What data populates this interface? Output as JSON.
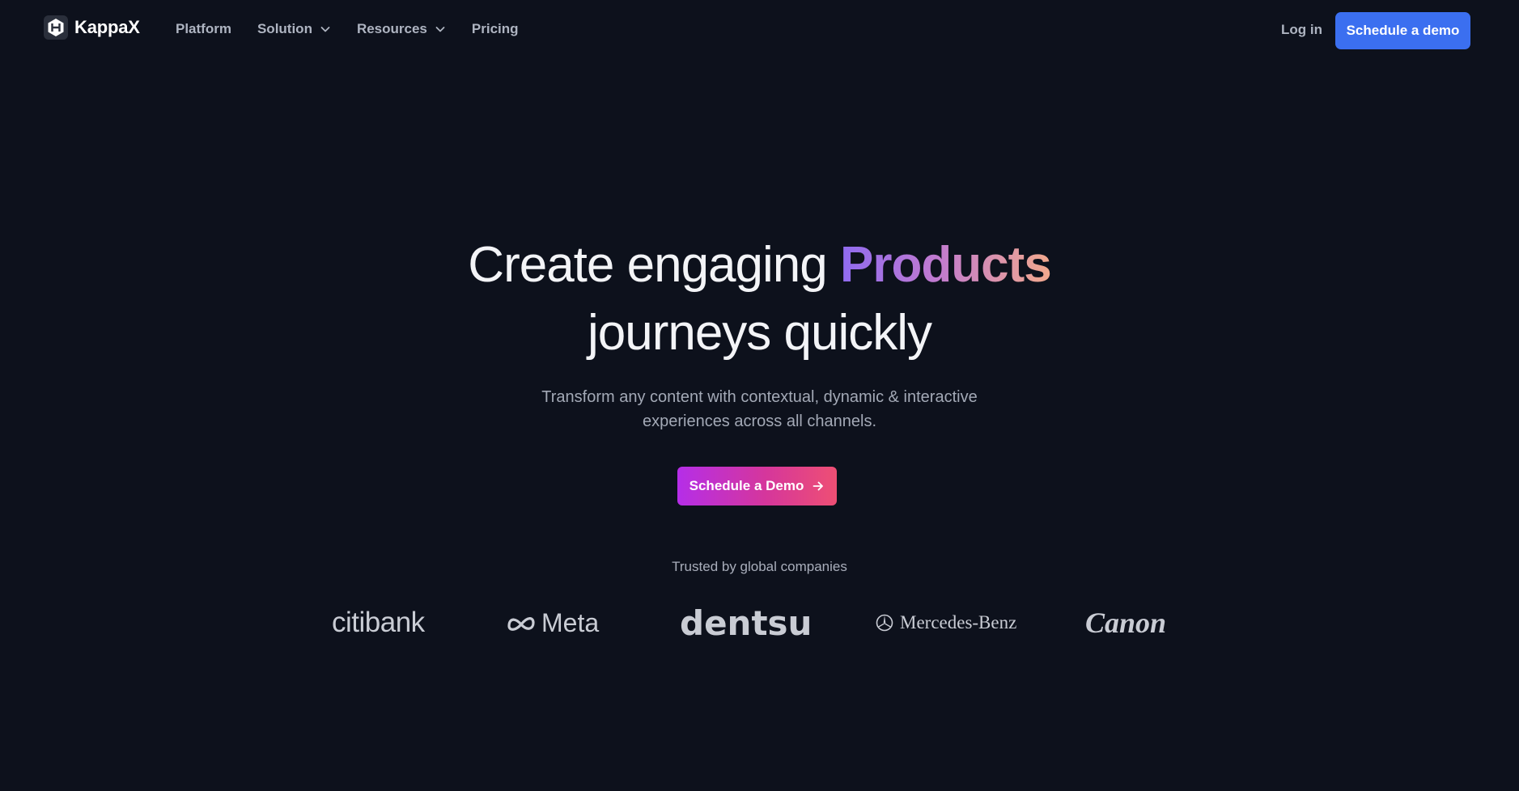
{
  "nav": {
    "brand": "KappaX",
    "brand_icon": "hexagon-logo-icon",
    "links": [
      {
        "label": "Platform",
        "has_dropdown": false
      },
      {
        "label": "Solution",
        "has_dropdown": true
      },
      {
        "label": "Resources",
        "has_dropdown": true
      },
      {
        "label": "Pricing",
        "has_dropdown": false
      }
    ],
    "login": "Log in",
    "cta": "Schedule a demo",
    "cta_color": "#3b6ff0"
  },
  "hero": {
    "title_part1": "Create engaging ",
    "title_accent": "Products",
    "title_part2": "journeys quickly",
    "subtitle": "Transform any content with contextual, dynamic & interactive experiences across all channels.",
    "cta": "Schedule a Demo",
    "cta_icon": "arrow-right-icon",
    "cta_gradient": [
      "#b52ee8",
      "#ee4f74"
    ]
  },
  "trust": {
    "label": "Trusted by global companies",
    "logos": [
      "citibank",
      "Meta",
      "dentsu",
      "Mercedes-Benz",
      "Canon"
    ]
  },
  "colors": {
    "background": "#0d111c",
    "accent_gradient": [
      "#8f6bf0",
      "#f2a98d"
    ]
  }
}
